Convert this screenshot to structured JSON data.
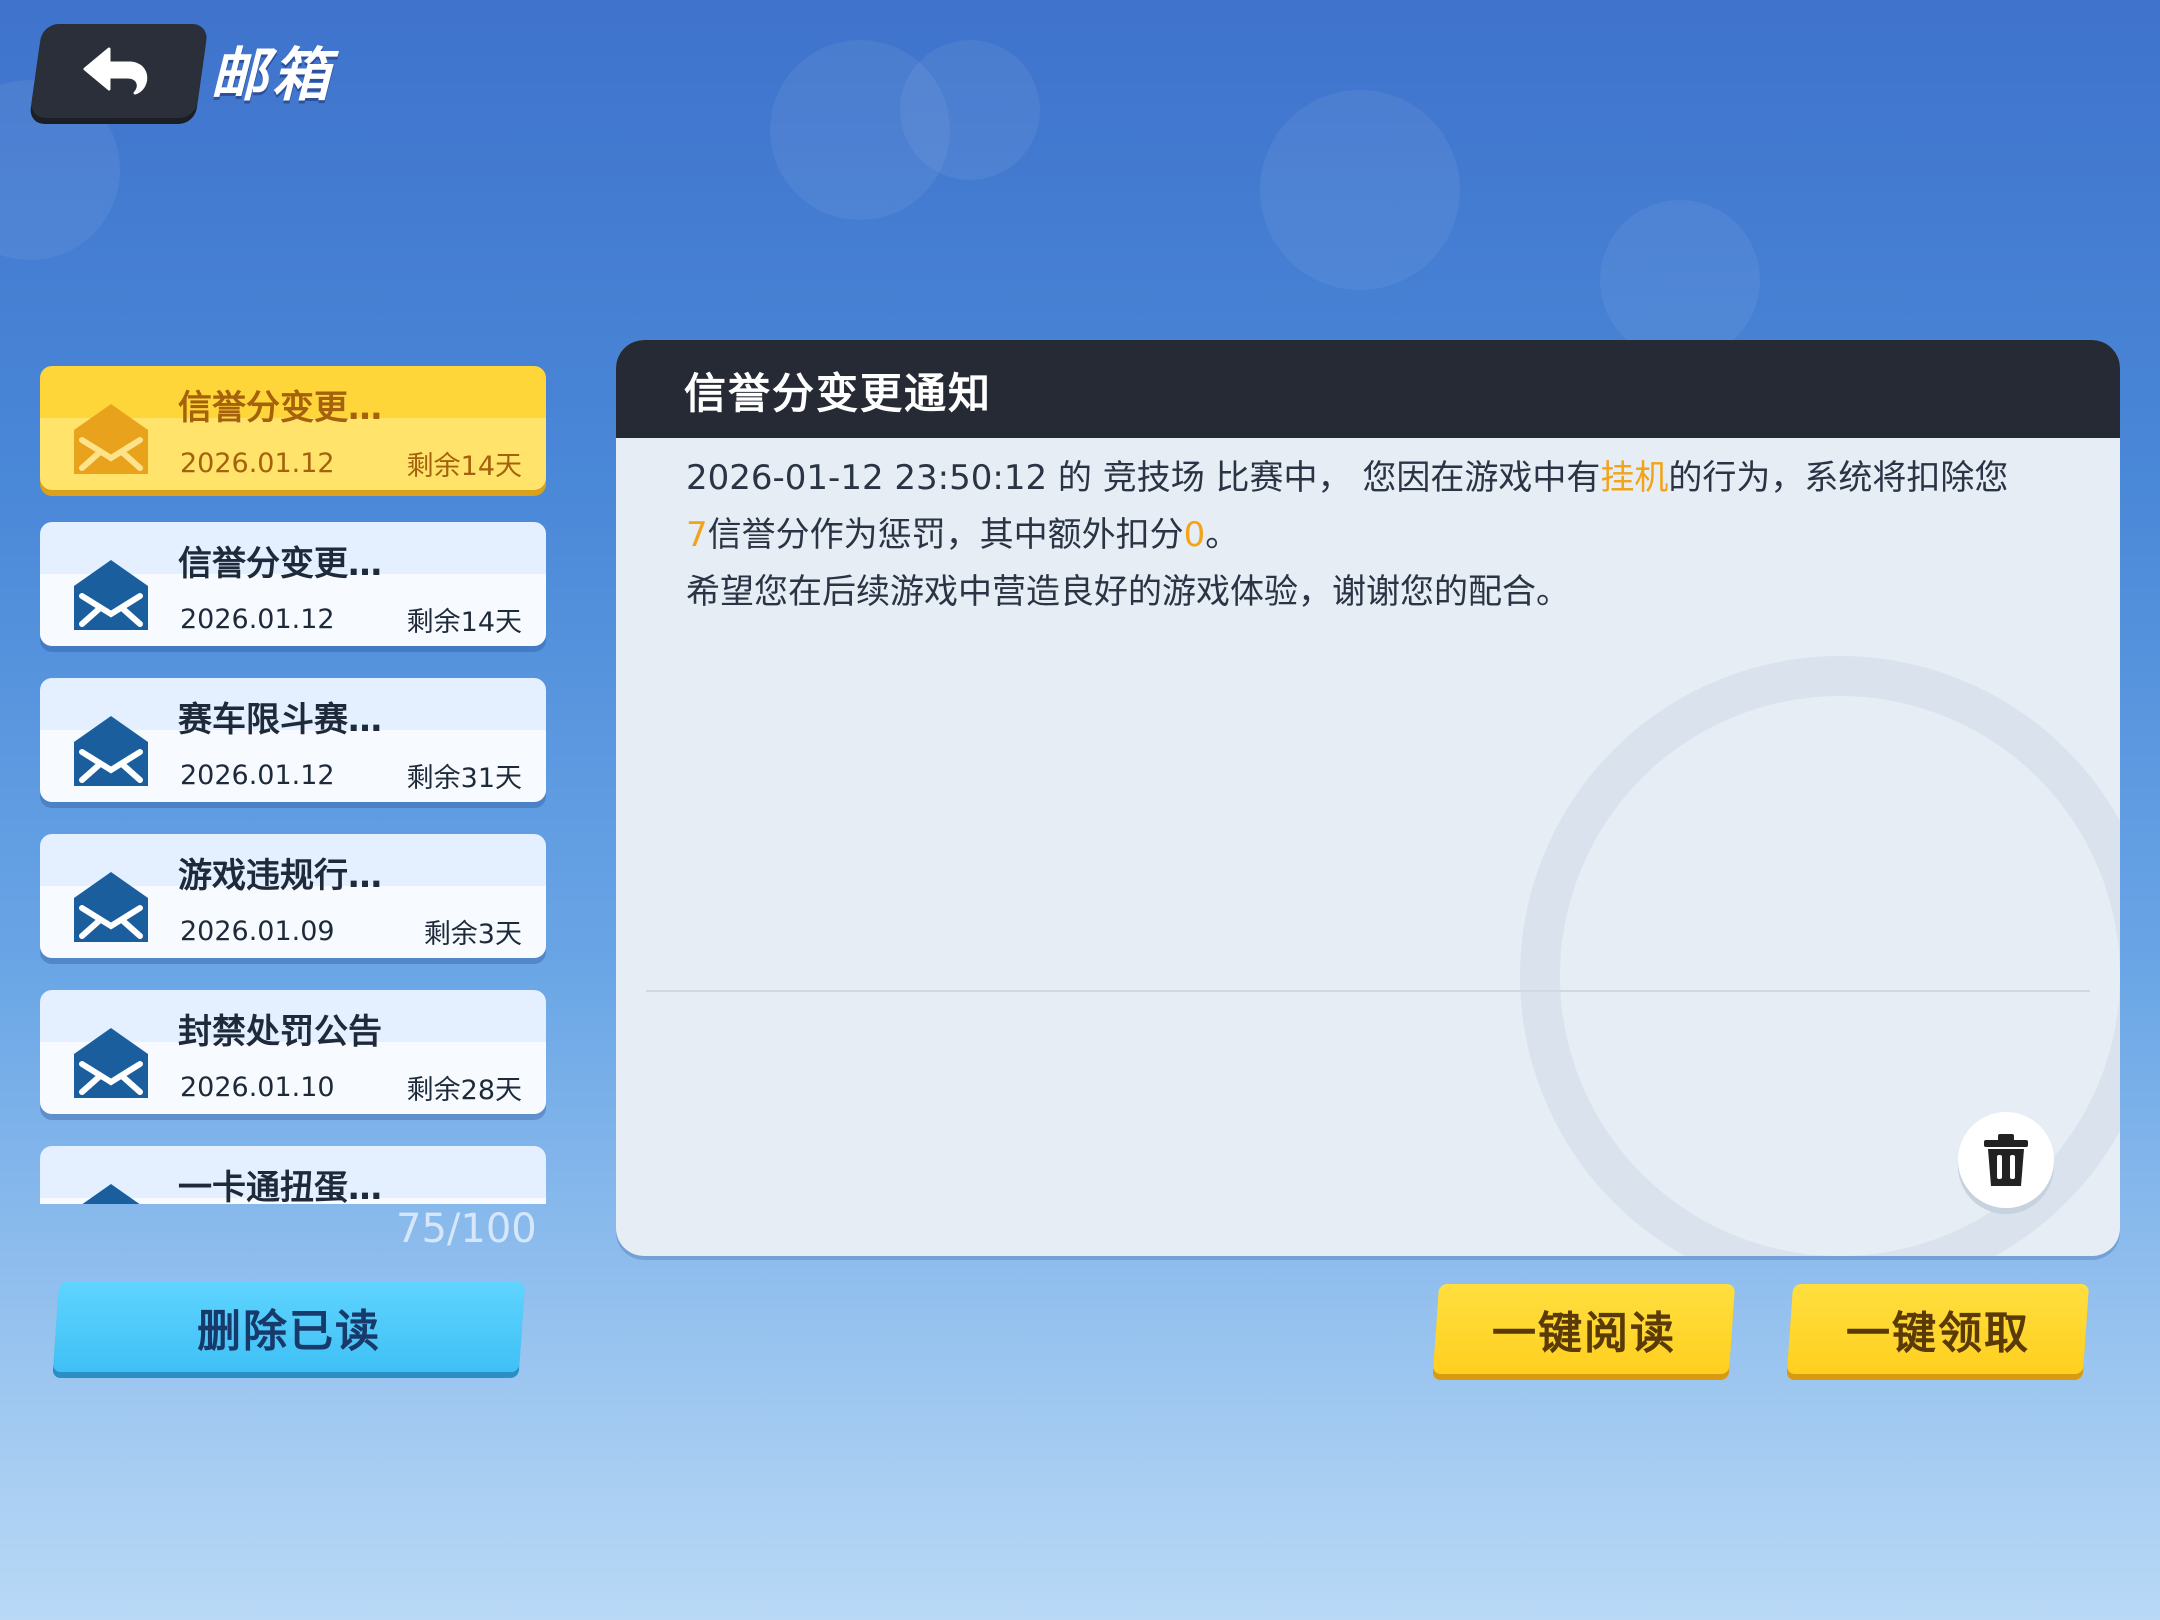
{
  "header": {
    "title": "邮箱"
  },
  "mails": [
    {
      "name": "信誉分变更…",
      "date": "2026.01.12",
      "remain": "剩余14天",
      "selected": true
    },
    {
      "name": "信誉分变更…",
      "date": "2026.01.12",
      "remain": "剩余14天",
      "selected": false
    },
    {
      "name": "赛车限斗赛…",
      "date": "2026.01.12",
      "remain": "剩余31天",
      "selected": false
    },
    {
      "name": "游戏违规行…",
      "date": "2026.01.09",
      "remain": "剩余3天",
      "selected": false
    },
    {
      "name": "封禁处罚公告",
      "date": "2026.01.10",
      "remain": "剩余28天",
      "selected": false
    },
    {
      "name": "一卡通扭蛋…",
      "date": "",
      "remain": "",
      "selected": false
    }
  ],
  "count": "75/100",
  "buttons": {
    "delete_read": "删除已读",
    "read_all": "一键阅读",
    "claim_all": "一键领取"
  },
  "detail": {
    "title": "信誉分变更通知",
    "line1_a": "2026-01-12 23:50:12 的 竞技场 比赛中， 您因在游戏中有",
    "line1_hl": "挂机",
    "line1_b": "的行为，系统将扣除您",
    "line2_hl1": "7",
    "line2_a": "信誉分作为惩罚，其中额外扣分",
    "line2_hl2": "0",
    "line2_b": "。",
    "line3": "希望您在后续游戏中营造良好的游戏体验，谢谢您的配合。"
  },
  "colors": {
    "highlight": "#f2a318",
    "selected_item": "#ffd63a",
    "mail_icon": "#1b5e9e"
  }
}
